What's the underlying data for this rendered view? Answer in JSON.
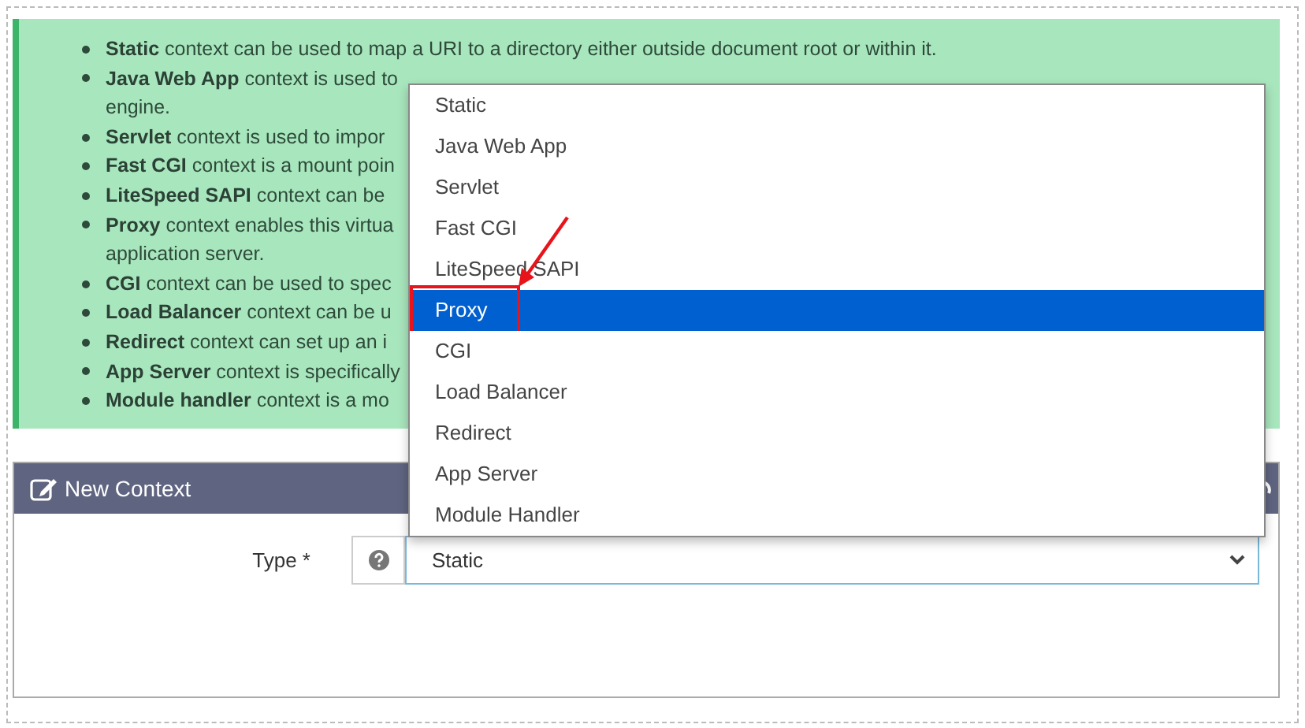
{
  "info_list": [
    {
      "text": "**Static** context can be used to map a URI to a directory either outside document root or within it."
    },
    {
      "text": "**Java Web App** context is used to",
      "continuation": "engine."
    },
    {
      "text": "**Servlet** context is used to impor"
    },
    {
      "text": "**Fast CGI** context is a mount poin"
    },
    {
      "text": "**LiteSpeed SAPI** context can be"
    },
    {
      "text": "**Proxy** context enables this virtua",
      "continuation": "application server."
    },
    {
      "text": "**CGI** context can be used to spec"
    },
    {
      "text": "**Load Balancer** context can be u"
    },
    {
      "text": "**Redirect** context can set up an i"
    },
    {
      "text": "**App Server** context is specifically"
    },
    {
      "text": "**Module handler** context is a mo"
    }
  ],
  "panel": {
    "title": "New Context"
  },
  "form": {
    "label": "Type *",
    "select": {
      "value": "Static",
      "open": true,
      "options": [
        {
          "label": "Static",
          "highlighted": false
        },
        {
          "label": "Java Web App",
          "highlighted": false
        },
        {
          "label": "Servlet",
          "highlighted": false
        },
        {
          "label": "Fast CGI",
          "highlighted": false
        },
        {
          "label": "LiteSpeed SAPI",
          "highlighted": false
        },
        {
          "label": "Proxy",
          "highlighted": true
        },
        {
          "label": "CGI",
          "highlighted": false
        },
        {
          "label": "Load Balancer",
          "highlighted": false
        },
        {
          "label": "Redirect",
          "highlighted": false
        },
        {
          "label": "App Server",
          "highlighted": false
        },
        {
          "label": "Module Handler",
          "highlighted": false
        }
      ]
    }
  }
}
